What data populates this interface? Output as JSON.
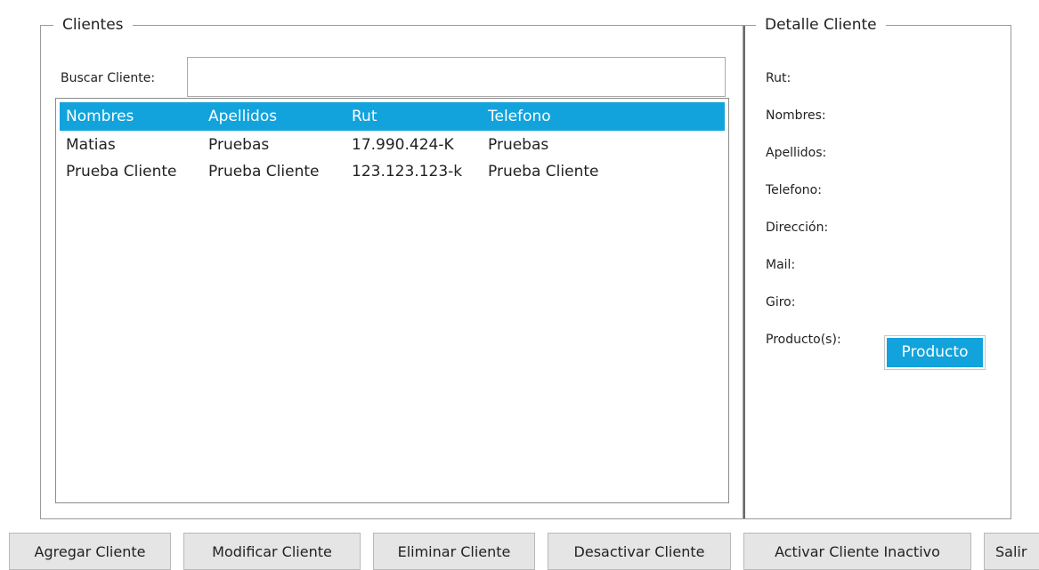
{
  "clientes_group": {
    "title": "Clientes",
    "search_label": "Buscar Cliente:",
    "search_value": ""
  },
  "client_list": {
    "columns": [
      "Nombres",
      "Apellidos",
      "Rut",
      "Telefono"
    ],
    "rows": [
      [
        "Matias",
        "Pruebas",
        "17.990.424-K",
        "Pruebas"
      ],
      [
        "Prueba Cliente",
        "Prueba Cliente",
        "123.123.123-k",
        "Prueba Cliente"
      ]
    ]
  },
  "detalle_group": {
    "title": "Detalle Cliente",
    "labels": [
      "Rut:",
      "Nombres:",
      "Apellidos:",
      "Telefono:",
      "Dirección:",
      "Mail:",
      "Giro:",
      "Producto(s):"
    ],
    "producto_item": "Producto"
  },
  "buttons": {
    "agregar": "Agregar Cliente",
    "modificar": "Modificar Cliente",
    "eliminar": "Eliminar Cliente",
    "desactivar": "Desactivar Cliente",
    "activar": "Activar Cliente Inactivo",
    "salir": "Salir"
  },
  "colors": {
    "accent": "#12a3dc"
  }
}
